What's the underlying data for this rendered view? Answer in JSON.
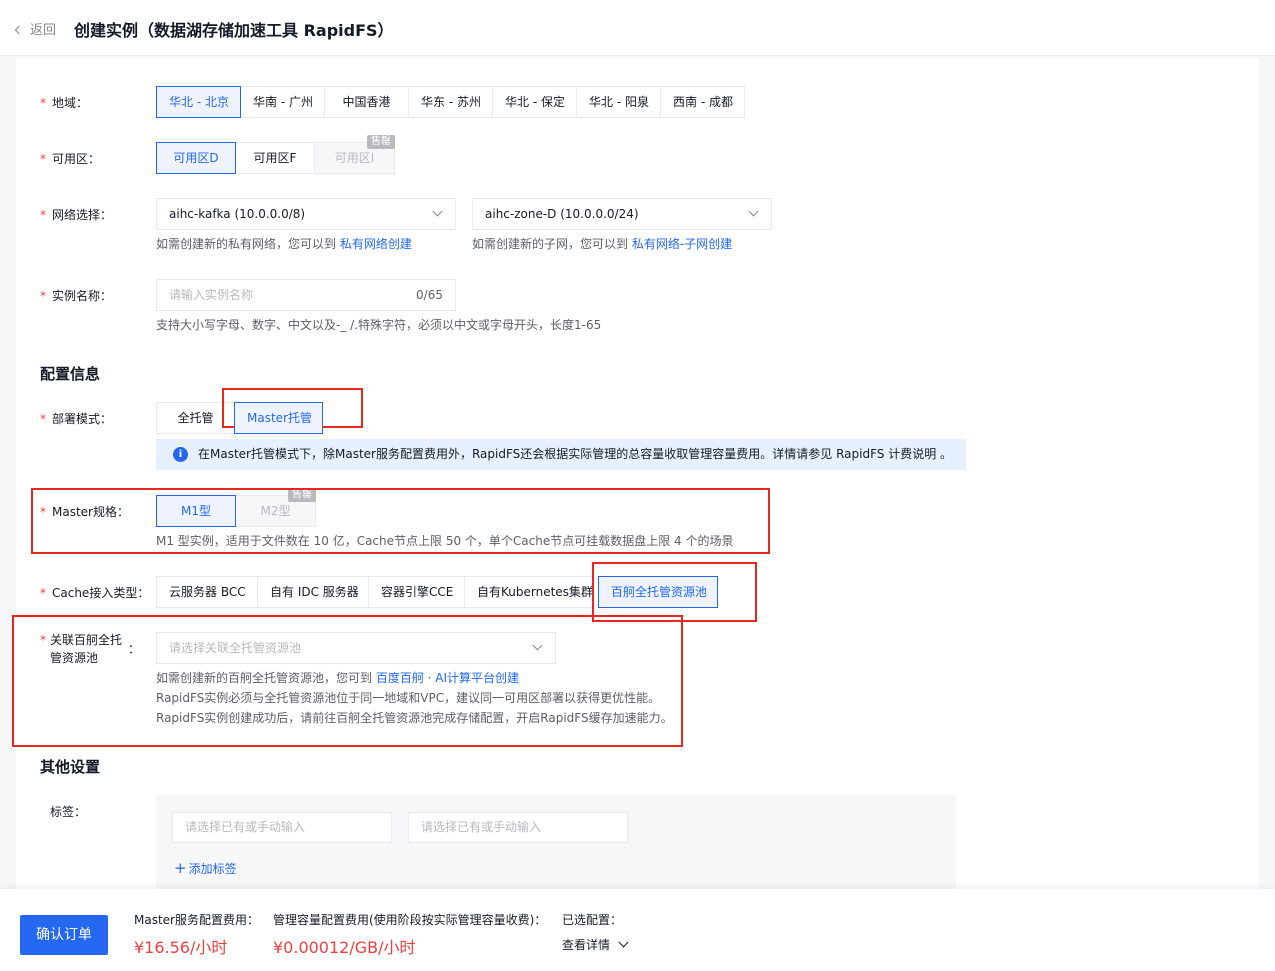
{
  "header": {
    "back_label": "返回",
    "title": "创建实例（数据湖存储加速工具 RapidFS）"
  },
  "region": {
    "label": "地域",
    "options": [
      "华北 - 北京",
      "华南 - 广州",
      "中国香港",
      "华东 - 苏州",
      "华北 - 保定",
      "华北 - 阳泉",
      "西南 - 成都"
    ],
    "selected": "华北 - 北京"
  },
  "zone": {
    "label": "可用区",
    "options": [
      "可用区D",
      "可用区F",
      "可用区I"
    ],
    "selected": "可用区D",
    "soldout_badge": "售罄"
  },
  "network": {
    "label": "网络选择",
    "vpc_value": "aihc-kafka (10.0.0.0/8)",
    "subnet_value": "aihc-zone-D (10.0.0.0/24)",
    "vpc_hint": "如需创建新的私有网络，您可以到",
    "vpc_link": "私有网络创建",
    "subnet_hint": "如需创建新的子网，您可以到",
    "subnet_link": "私有网络-子网创建"
  },
  "instance_name": {
    "label": "实例名称",
    "placeholder": "请输入实例名称",
    "counter": "0/65",
    "hint": "支持大小写字母、数字、中文以及-_ /.特殊字符，必须以中文或字母开头，长度1-65"
  },
  "config_section": "配置信息",
  "deploy_mode": {
    "label": "部署模式",
    "options": [
      "全托管",
      "Master托管"
    ],
    "selected": "Master托管",
    "info": "在Master托管模式下，除Master服务配置费用外，RapidFS还会根据实际管理的总容量收取管理容量费用。详情请参见 RapidFS 计费说明 。"
  },
  "master_spec": {
    "label": "Master规格",
    "options": [
      "M1型",
      "M2型"
    ],
    "selected": "M1型",
    "soldout_badge": "售罄",
    "hint": "M1 型实例，适用于文件数在 10 亿，Cache节点上限 50 个，单个Cache节点可挂载数据盘上限 4 个的场景"
  },
  "cache_type": {
    "label": "Cache接入类型",
    "options": [
      "云服务器 BCC",
      "自有 IDC 服务器",
      "容器引擎CCE",
      "自有Kubernetes集群",
      "百舸全托管资源池"
    ],
    "selected": "百舸全托管资源池"
  },
  "resource_pool": {
    "label_line1": "关联百舸全托",
    "label_line2": "管资源池",
    "colon": "：",
    "placeholder": "请选择关联全托管资源池",
    "hint1": "如需创建新的百舸全托管资源池，您可到",
    "hint1_link": "百度百舸 · AI计算平台创建",
    "hint2": "RapidFS实例必须与全托管资源池位于同一地域和VPC，建议同一可用区部署以获得更优性能。",
    "hint3": "RapidFS实例创建成功后，请前往百舸全托管资源池完成存储配置，开启RapidFS缓存加速能力。"
  },
  "other_section": "其他设置",
  "tags": {
    "label": "标签",
    "key_placeholder": "请选择已有或手动输入",
    "value_placeholder": "请选择已有或手动输入",
    "add_label": "添加标签"
  },
  "footer": {
    "confirm_label": "确认订单",
    "master_fee_label": "Master服务配置费用：",
    "master_fee_value": "¥16.56/小时",
    "capacity_fee_label": "管理容量配置费用(使用阶段按实际管理容量收费)：",
    "capacity_fee_value": "¥0.00012/GB/小时",
    "selected_label": "已选配置：",
    "detail_label": "查看详情"
  },
  "colors": {
    "primary": "#2468f2",
    "price": "#f33e3e",
    "highlight_box": "#e8281e"
  }
}
